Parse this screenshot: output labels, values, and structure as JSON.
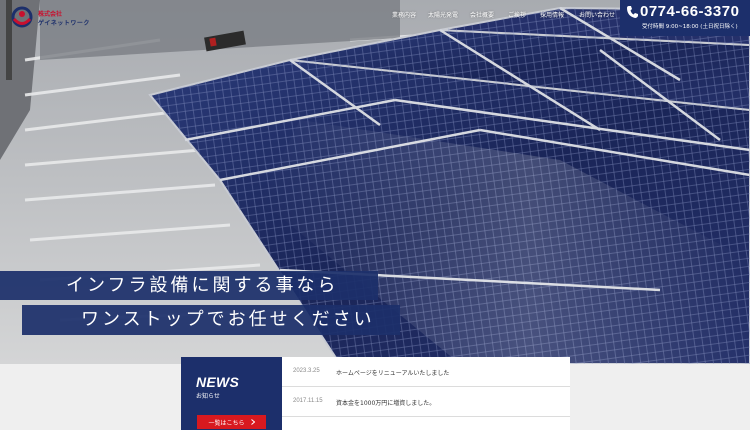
{
  "header": {
    "logo": {
      "company_line": "株式会社",
      "brand_line": "ゲイネットワーク"
    },
    "nav": [
      {
        "label": "業務内容",
        "icon": null
      },
      {
        "label": "太陽光発電",
        "icon": null
      },
      {
        "label": "会社概要",
        "icon": null
      },
      {
        "label": "ご挨拶",
        "icon": null
      },
      {
        "label": "採用情報",
        "icon": null
      },
      {
        "label": "お問い合わせ",
        "icon": null
      }
    ],
    "contact": {
      "phone": "0774-66-3370",
      "hours": "受付時間 9:00~18:00 (土日祝日除く)",
      "icon": "phone-icon"
    }
  },
  "hero": {
    "catch_line1": "インフラ設備に関する事なら",
    "catch_line2": "ワンストップでお任せください"
  },
  "news": {
    "title": "NEWS",
    "subtitle": "お知らせ",
    "more_label": "一覧はこちら",
    "more_icon": "chevron-right-icon",
    "items": [
      {
        "date": "2023.3.25",
        "text": "ホームページをリニューアルいたしました"
      },
      {
        "date": "2017.11.15",
        "text": "資本金を1000万円に増資しました。"
      }
    ]
  },
  "colors": {
    "navy": "#1c2f6b",
    "red": "#d8191f",
    "panel": "#1d2a5e"
  }
}
